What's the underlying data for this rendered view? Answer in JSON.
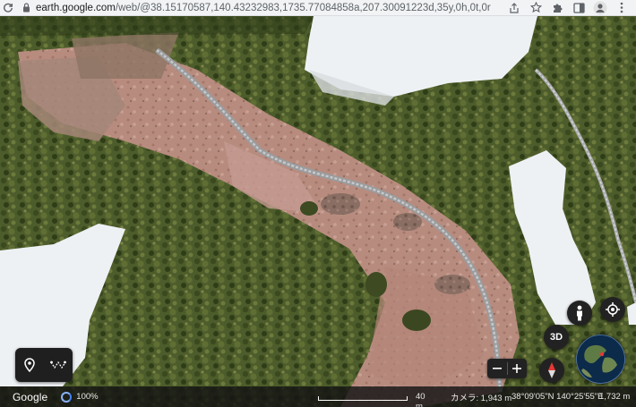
{
  "browser": {
    "url_host": "earth.google.com",
    "url_path": "/web/@38.15170587,140.43232983,1735.77084858a,207.30091223d,35y,0h,0t,0r"
  },
  "map": {
    "controls": {
      "three_d_label": "3D"
    },
    "status_bar": {
      "logo": "Google",
      "load_percent": "100%",
      "scale_label": "40 m",
      "camera": "カメラ: 1,943 m",
      "coordinates": "38°09'05\"N 140°25'55\"E",
      "altitude": "1,732 m"
    }
  },
  "colors": {
    "vegetation": "#4a5a2a",
    "snow": "#eef1f4",
    "bare_earth": "#b98a7c",
    "accent_blue": "#4285f4"
  }
}
